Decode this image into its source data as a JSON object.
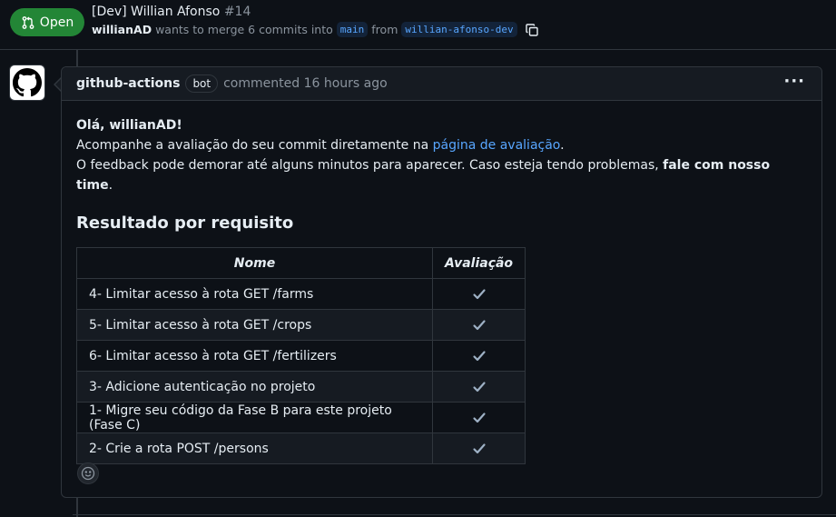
{
  "pr": {
    "state": "Open",
    "title": "[Dev] Willian Afonso",
    "number": "#14",
    "author": "willianAD",
    "merge_text": "wants to merge 6 commits into",
    "base_branch": "main",
    "from_text": "from",
    "head_branch": "willian-afonso-dev"
  },
  "comment": {
    "author": "github-actions",
    "badge": "bot",
    "time": "commented 16 hours ago",
    "greeting": "Olá, willianAD!",
    "line1_prefix": "Acompanhe a avaliação do seu commit diretamente na ",
    "line1_link": "página de avaliação",
    "line1_suffix": ".",
    "line2_prefix": "O feedback pode demorar até alguns minutos para aparecer. Caso esteja tendo problemas, ",
    "line2_bold": "fale com nosso time",
    "line2_suffix": ".",
    "heading": "Resultado por requisito",
    "table": {
      "headers": [
        "Nome",
        "Avaliação"
      ],
      "rows": [
        {
          "name": "4- Limitar acesso à rota GET /farms",
          "status": "check"
        },
        {
          "name": "5- Limitar acesso à rota GET /crops",
          "status": "check"
        },
        {
          "name": "6- Limitar acesso à rota GET /fertilizers",
          "status": "check"
        },
        {
          "name": "3- Adicione autenticação no projeto",
          "status": "check"
        },
        {
          "name": "1- Migre seu código da Fase B para este projeto (Fase C)",
          "status": "check"
        },
        {
          "name": "2- Crie a rota POST /persons",
          "status": "check"
        }
      ]
    }
  },
  "colors": {
    "background": "#0d1117",
    "open_badge": "#238636",
    "link": "#58a6ff",
    "border": "#30363d"
  }
}
